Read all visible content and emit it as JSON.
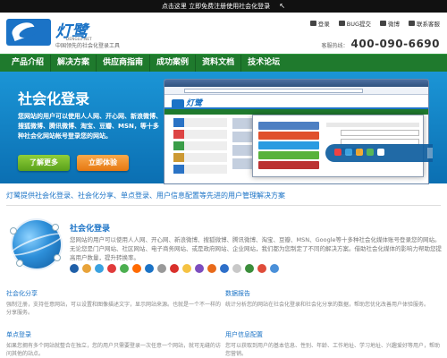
{
  "topbar": {
    "text": "点击这里 立即免费注册使用社会化登录",
    "cursor_icon": "mouse-cursor-icon"
  },
  "header": {
    "logo_text": "灯鹭",
    "logo_sub": "DENGLU.NET",
    "tagline": "中国领先的社会化登录工具",
    "links": [
      {
        "label": "登录",
        "icon": "user-icon"
      },
      {
        "label": "BUG提交",
        "icon": "bug-icon"
      },
      {
        "label": "微博",
        "icon": "weibo-icon"
      },
      {
        "label": "联系客服",
        "icon": "chat-icon"
      }
    ],
    "hotline_label": "客服热线：",
    "hotline_number": "400-090-6690"
  },
  "nav": {
    "items": [
      "产品介绍",
      "解决方案",
      "供应商指南",
      "成功案例",
      "资料文档",
      "技术论坛"
    ]
  },
  "hero": {
    "title": "社会化登录",
    "desc": "您网站的用户可以使用人人网、开心网、新浪微博、搜狐微博、腾讯微博、淘宝、豆瓣、MSN，等十多种社会化网站帐号登录您的网站。",
    "btn_more": "了解更多",
    "btn_try": "立即体验"
  },
  "section_title": "灯鹭提供社会化登录、社会化分享、单点登录、用户信息配置等先进的用户管理解决方案",
  "login_block": {
    "title": "社会化登录",
    "desc": "您网站的用户可以使用人人网、开心网、新浪微博、搜狐微博、腾讯微博、淘宝、豆瓣、MSN、Google等十多种社会化媒体账号登录您的网站。 无论您是门户网站、社区网站、电子商务网站、或是政府网站、企业网站，我们都为您制定了不同的解决方案。借助社会化媒体的影响力帮助您提高用户数量，提升转换率。",
    "icon_colors": [
      "#1f5fa8",
      "#e8a33a",
      "#3aa2e0",
      "#e03b3b",
      "#4caf50",
      "#ff6a00",
      "#1b73c6",
      "#999999",
      "#d9302b",
      "#f5c242",
      "#7c4dbe",
      "#e86a1a",
      "#2d6fc9",
      "#c8c8c8",
      "#3b8e3b",
      "#df4c3a",
      "#4a90d9"
    ]
  },
  "features": [
    {
      "title": "社会化分享",
      "desc": "强制注册，支持任意网站，可以设置和图像描述文字，显示网站来源。也就是一个不一样的分享服务。"
    },
    {
      "title": "数据报告",
      "desc": "统计分析您的网站在社会化登录和社会化分享的数据，帮助您优化改善用户体验服务。"
    },
    {
      "title": "单点登录",
      "desc": "如果您拥有多个网站就整合在独立，您的用户只需要登录一次任意一个网站，就可无缝的访问其他的站点。"
    },
    {
      "title": "用户信息配置",
      "desc": "您可以获取到用户的基本信息、性别、年龄、工作地址、学习地址、兴趣爱好等用户，帮助您营销。"
    }
  ]
}
